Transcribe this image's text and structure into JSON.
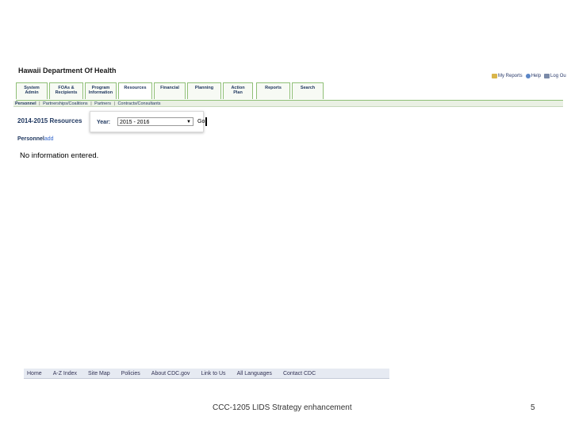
{
  "header": {
    "org_title": "Hawaii Department Of Health"
  },
  "utility_links": [
    {
      "label": "My Reports",
      "icon": "report-icon"
    },
    {
      "label": "Help",
      "icon": "help-icon"
    },
    {
      "label": "Log Ou",
      "icon": "logout-icon"
    }
  ],
  "tabs": [
    {
      "line1": "System",
      "line2": "Admin"
    },
    {
      "line1": "FOAs &",
      "line2": "Recipients"
    },
    {
      "line1": "Program",
      "line2": "Information"
    },
    {
      "line1": "Resources",
      "line2": "",
      "active": true
    },
    {
      "line1": "Financial",
      "line2": ""
    },
    {
      "line1": "Planning",
      "line2": ""
    },
    {
      "line1": "Action",
      "line2": "Plan"
    },
    {
      "line1": "Reports",
      "line2": ""
    },
    {
      "line1": "Search",
      "line2": ""
    }
  ],
  "subnav": {
    "items": [
      "Personnel",
      "Partnerships/Coalitions",
      "Partners",
      "Contracts/Consultants"
    ],
    "separator": "|"
  },
  "resources": {
    "title": "2014-2015 Resources",
    "year_label": "Year:",
    "year_value": "2015 - 2016",
    "go_label": "Go"
  },
  "personnel": {
    "label": "Personnel",
    "add_label": "add"
  },
  "empty_message": "No information entered.",
  "footer_links": [
    "Home",
    "A-Z Index",
    "Site Map",
    "Policies",
    "About CDC.gov",
    "Link to Us",
    "All Languages",
    "Contact CDC"
  ],
  "slide": {
    "caption": "CCC-1205 LIDS Strategy enhancement",
    "page_number": "5"
  }
}
